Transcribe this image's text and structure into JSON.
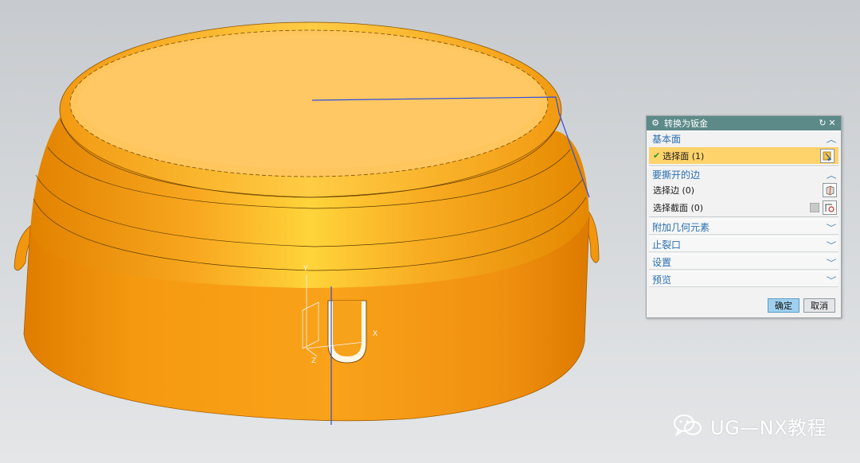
{
  "dialog": {
    "title": "转换为钣金",
    "icons": {
      "title": "gear-icon",
      "reset": "reset-icon",
      "close": "close-icon"
    },
    "sections": {
      "base_face": {
        "title": "基本面",
        "select_label": "选择面 (1)",
        "state": "expanded"
      },
      "edges_to_rip": {
        "title": "要撕开的边",
        "select_edge_label": "选择边 (0)",
        "select_section_label": "选择截面 (0)",
        "state": "expanded"
      },
      "additional_geometry": {
        "title": "附加几何元素",
        "state": "collapsed"
      },
      "relief": {
        "title": "止裂口",
        "state": "collapsed"
      },
      "settings": {
        "title": "设置",
        "state": "collapsed"
      },
      "preview": {
        "title": "预览",
        "state": "collapsed"
      }
    },
    "ok_label": "确定",
    "cancel_label": "取消"
  },
  "viewport": {
    "axis_labels": {
      "x": "X",
      "y": "Y",
      "z": "Z"
    },
    "colors": {
      "part": "#f7a21b",
      "top_face": "#ffc65e",
      "selection_line": "#3050d8"
    }
  },
  "watermark": {
    "text": "UG—NX教程",
    "icon": "wechat-icon"
  }
}
